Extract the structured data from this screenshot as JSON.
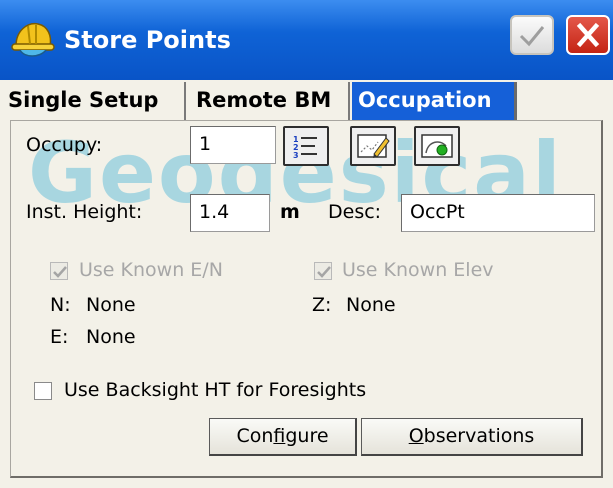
{
  "window": {
    "title": "Store Points"
  },
  "tabs": [
    {
      "label": "Single Setup",
      "active": false
    },
    {
      "label": "Remote BM",
      "active": false
    },
    {
      "label": "Occupation",
      "active": true
    }
  ],
  "form": {
    "occupy": {
      "label": "Occupy:",
      "value": "1"
    },
    "inst_height": {
      "label": "Inst. Height:",
      "value": "1.4",
      "unit": "m"
    },
    "desc": {
      "label": "Desc:",
      "value": "OccPt"
    },
    "use_known_en": {
      "label": "Use Known E/N",
      "checked": true,
      "enabled": false
    },
    "use_known_elev": {
      "label": "Use Known Elev",
      "checked": true,
      "enabled": false
    },
    "north": {
      "label": "N:",
      "value": "None"
    },
    "east": {
      "label": "E:",
      "value": "None"
    },
    "elev": {
      "label": "Z:",
      "value": "None"
    },
    "backsight_ht": {
      "label": "Use Backsight HT for Foresights",
      "checked": false
    }
  },
  "buttons": {
    "configure": {
      "pre": "Con",
      "key": "f",
      "post": "igure"
    },
    "observations": {
      "pre": "",
      "key": "O",
      "post": "bservations"
    }
  },
  "watermark": "Geodesical",
  "icons": {
    "app": "hardhat-person-icon",
    "ok": "checkmark-icon",
    "close": "close-x-icon",
    "list": "numbered-list-icon",
    "map": "map-edit-icon",
    "instrument": "instrument-icon"
  },
  "colors": {
    "title_bar": "#0f63d6",
    "active_tab": "#1560d8",
    "close_button": "#d23a2a",
    "watermark": "#26a9d4"
  }
}
